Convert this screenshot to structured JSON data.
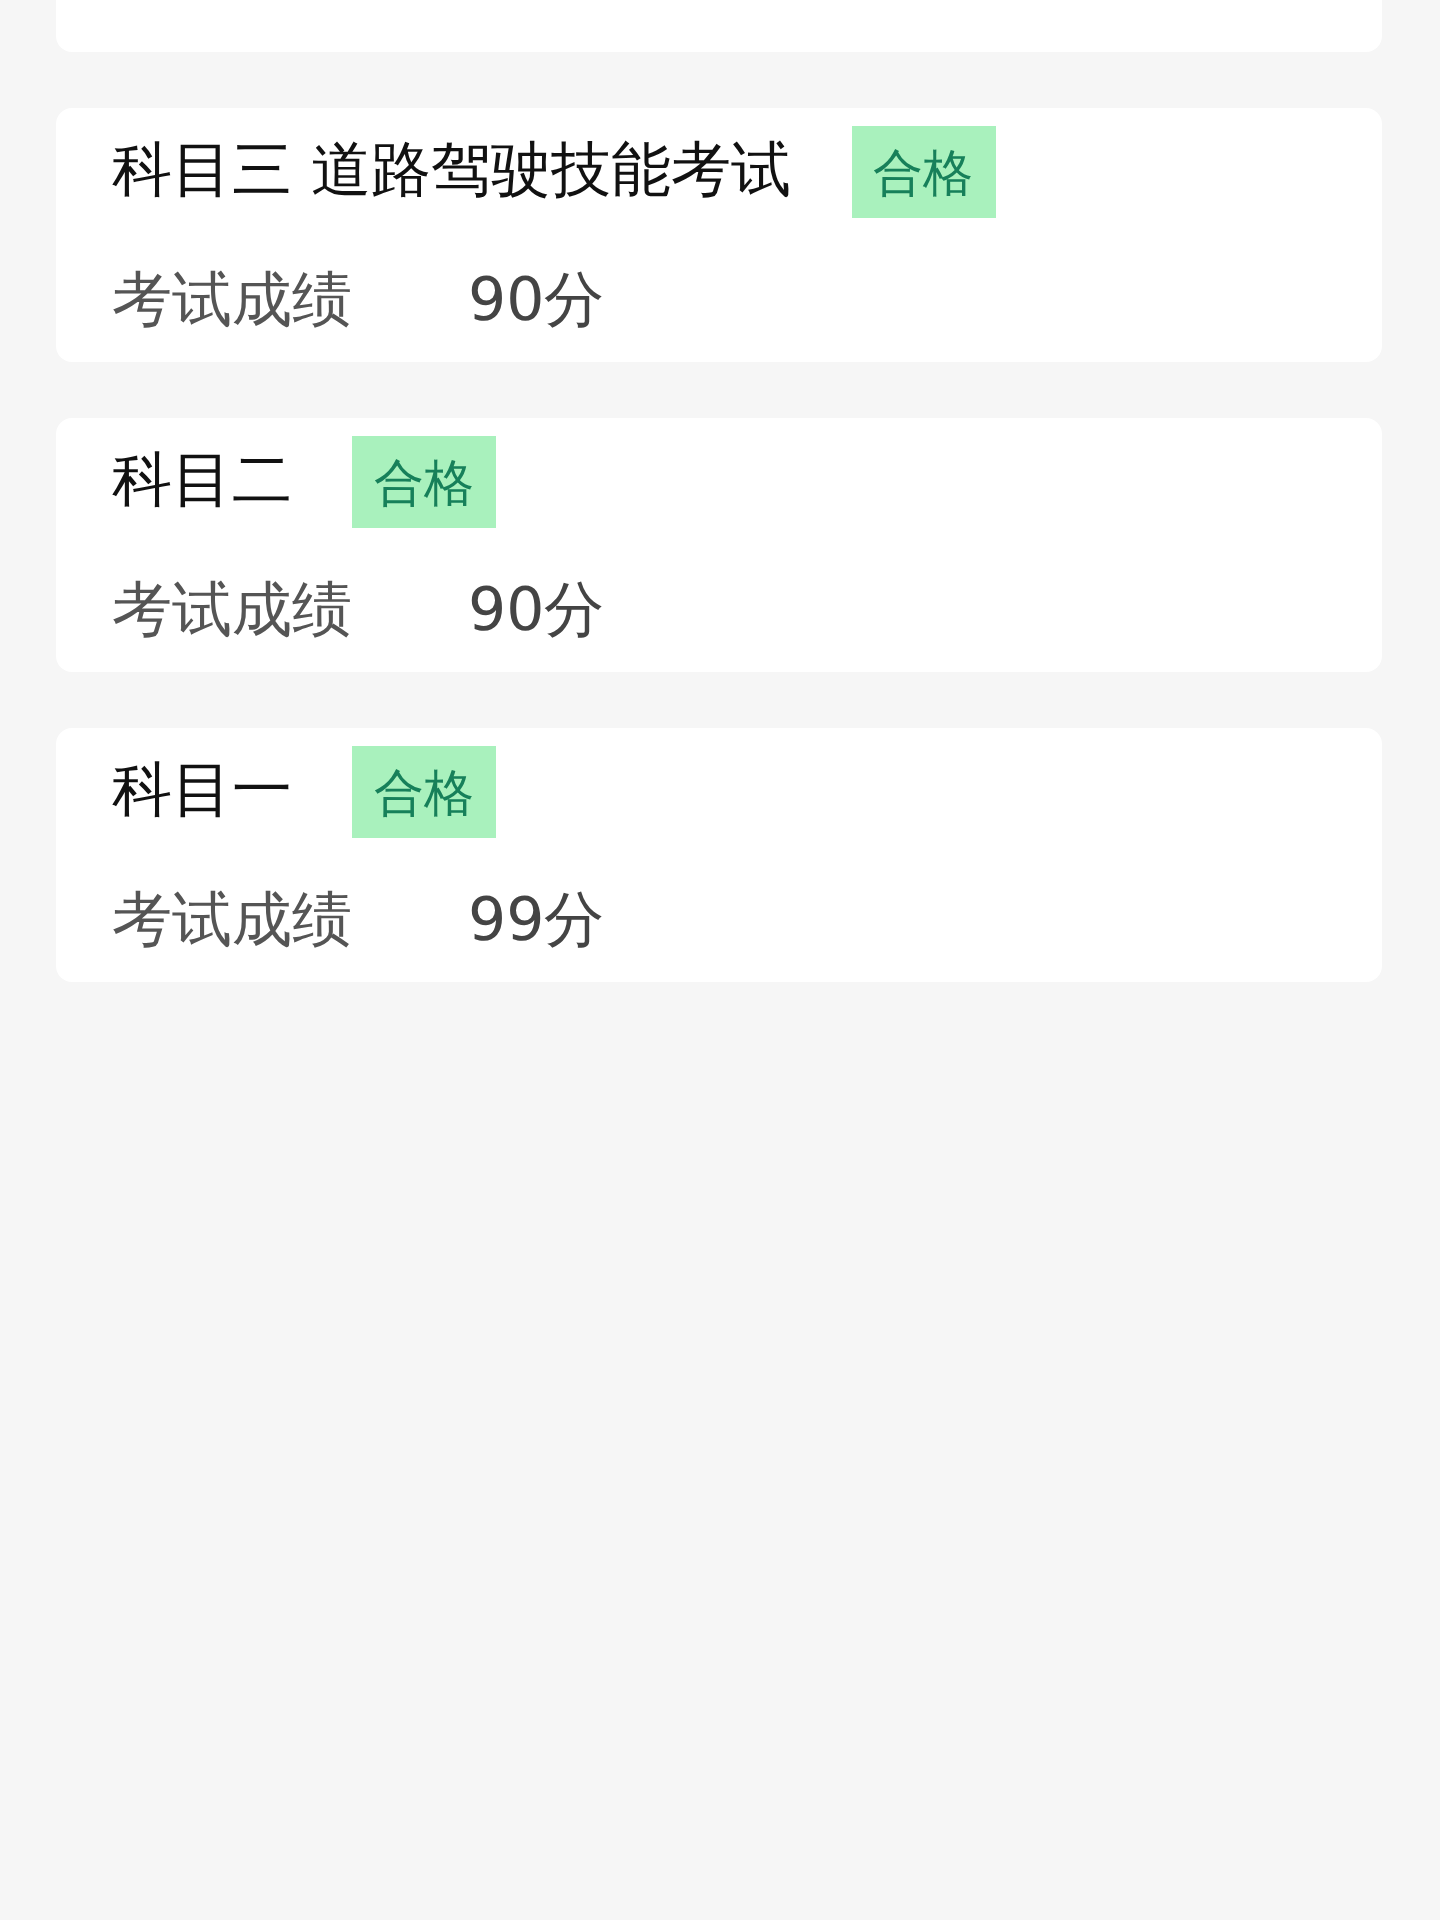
{
  "exams": [
    {
      "title": "科目三 道路驾驶技能考试",
      "badge": "合格",
      "score_label": "考试成绩",
      "score": "90分"
    },
    {
      "title": "科目二",
      "badge": "合格",
      "score_label": "考试成绩",
      "score": "90分"
    },
    {
      "title": "科目一",
      "badge": "合格",
      "score_label": "考试成绩",
      "score": "99分"
    }
  ]
}
